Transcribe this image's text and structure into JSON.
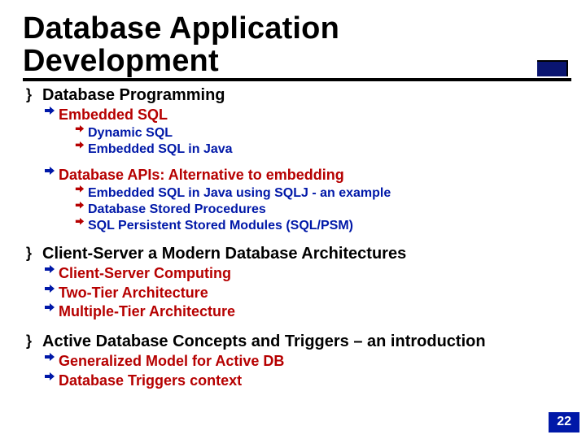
{
  "title_line1": "Database Application",
  "title_line2": "Development",
  "sections": [
    {
      "label": "Database Programming",
      "children": [
        {
          "label": "Embedded SQL",
          "children": [
            {
              "label": "Dynamic SQL"
            },
            {
              "label": "Embedded SQL in Java"
            }
          ]
        },
        {
          "label": "Database APIs: Alternative to embedding",
          "children": [
            {
              "label": "Embedded SQL in Java using SQLJ - an example"
            },
            {
              "label": "Database Stored Procedures"
            },
            {
              "label": "SQL Persistent Stored Modules (SQL/PSM)"
            }
          ]
        }
      ]
    },
    {
      "label": "Client-Server a Modern Database Architectures",
      "children": [
        {
          "label": "Client-Server Computing"
        },
        {
          "label": "Two-Tier Architecture"
        },
        {
          "label": "Multiple-Tier Architecture"
        }
      ]
    },
    {
      "label": "Active Database Concepts and Triggers – an introduction",
      "children": [
        {
          "label": "Generalized Model for Active DB"
        },
        {
          "label": "Database Triggers context"
        }
      ]
    }
  ],
  "page_number": "22",
  "bullets": {
    "lvl1": "}",
    "lvl2_arrow_color": "#0018a8",
    "lvl3_arrow_color": "#b60000"
  }
}
